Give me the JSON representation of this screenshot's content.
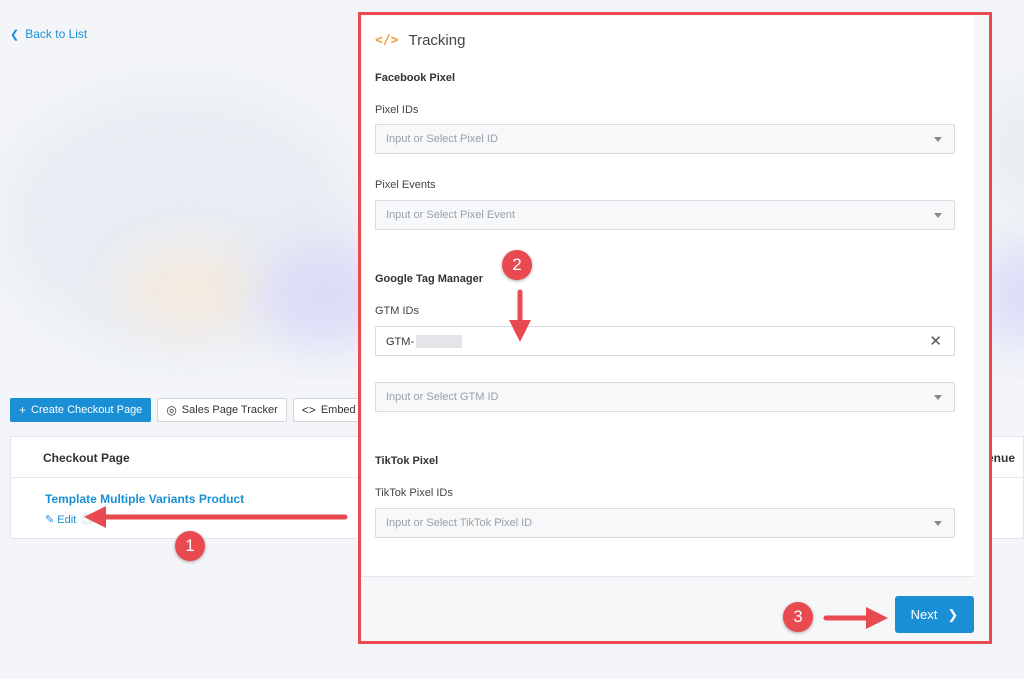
{
  "nav": {
    "back_label": "Back to List"
  },
  "toolbar": {
    "create_label": "Create Checkout Page",
    "tracker_label": "Sales Page Tracker",
    "embed_label": "Embed Checko"
  },
  "table": {
    "col_checkout": "Checkout Page",
    "col_revenue": "enue",
    "row": {
      "title": "Template Multiple Variants Product",
      "edit_label": "Edit"
    }
  },
  "modal": {
    "title": "Tracking",
    "facebook": {
      "section": "Facebook Pixel",
      "ids_label": "Pixel IDs",
      "ids_placeholder": "Input or Select Pixel ID",
      "events_label": "Pixel Events",
      "events_placeholder": "Input or Select Pixel Event"
    },
    "gtm": {
      "section": "Google Tag Manager",
      "ids_label": "GTM IDs",
      "selected_prefix": "GTM-",
      "placeholder": "Input or Select GTM ID"
    },
    "tiktok": {
      "section": "TikTok Pixel",
      "ids_label": "TikTok Pixel IDs",
      "placeholder": "Input or Select TikTok Pixel ID"
    },
    "next_label": "Next"
  },
  "annotations": {
    "badge1": "1",
    "badge2": "2",
    "badge3": "3"
  },
  "colors": {
    "accent": "#1a8fd6",
    "annotation": "#e84a4f",
    "icon_orange": "#f29a32"
  }
}
